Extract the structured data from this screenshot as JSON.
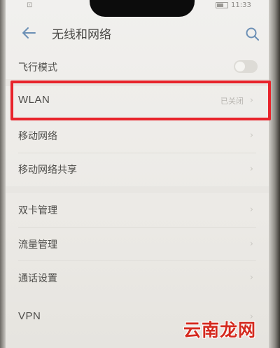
{
  "status_bar": {
    "left_text": "⊡",
    "time": "11:33"
  },
  "header": {
    "title": "无线和网络",
    "back_icon": "back-arrow-icon",
    "search_icon": "search-icon"
  },
  "settings": {
    "airplane_mode": {
      "label": "飞行模式",
      "enabled": false
    },
    "wlan": {
      "label": "WLAN",
      "status": "已关闭"
    },
    "mobile_network": {
      "label": "移动网络"
    },
    "hotspot": {
      "label": "移动网络共享"
    },
    "dual_sim": {
      "label": "双卡管理"
    },
    "data_usage": {
      "label": "流量管理"
    },
    "call_settings": {
      "label": "通话设置"
    },
    "vpn": {
      "label": "VPN"
    }
  },
  "chevron": "›",
  "watermark": "云南龙网",
  "colors": {
    "highlight": "#e8232b",
    "watermark": "#d42a1f",
    "accent_icon": "#6b8fb5"
  }
}
